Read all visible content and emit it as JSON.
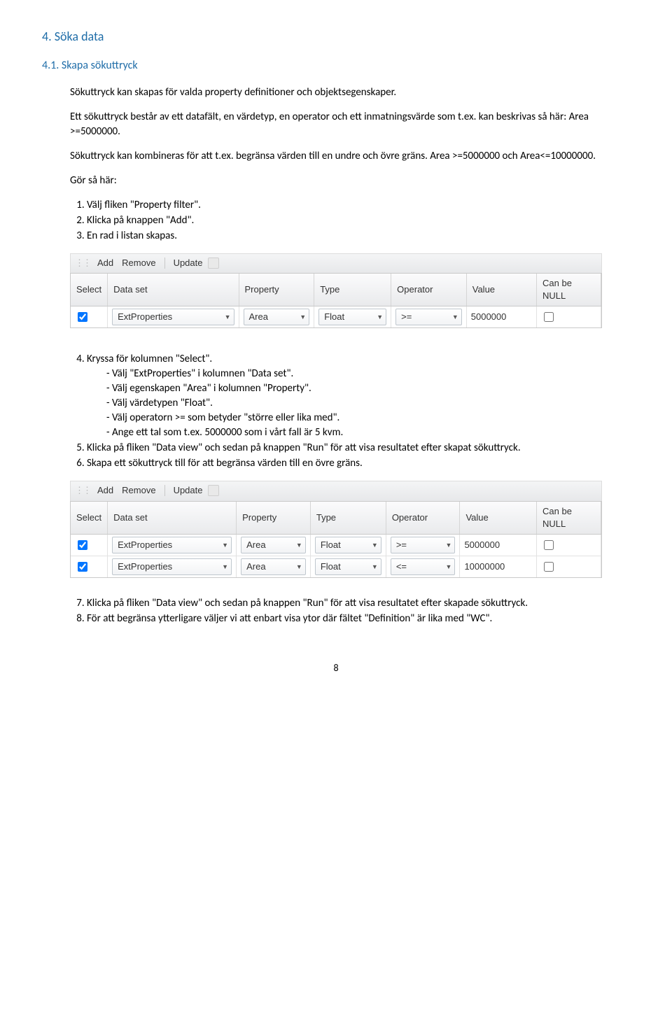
{
  "headings": {
    "h1": "4. Söka data",
    "h2": "4.1. Skapa sökuttryck"
  },
  "intro": {
    "p1": "Sökuttryck kan skapas för valda property definitioner och objektsegenskaper.",
    "p2": "Ett sökuttryck består av ett datafält, en värdetyp, en operator och ett inmatningsvärde som t.ex. kan beskrivas så här: Area >=5000000.",
    "p3": "Sökuttryck kan kombineras för att t.ex. begränsa värden till en undre och övre gräns. Area >=5000000 och Area<=10000000.",
    "p4": "Gör så här:"
  },
  "list1": {
    "i1": "Välj fliken \"Property filter\".",
    "i2": "Klicka på knappen \"Add\".",
    "i3": "En rad i listan skapas."
  },
  "toolbar": {
    "add": "Add",
    "remove": "Remove",
    "update": "Update"
  },
  "columns": {
    "select": "Select",
    "dataset": "Data set",
    "property": "Property",
    "type": "Type",
    "operator": "Operator",
    "value": "Value",
    "cannull": "Can be NULL"
  },
  "row1": {
    "dataset": "ExtProperties",
    "property": "Area",
    "type": "Float",
    "operator": ">=",
    "value": "5000000"
  },
  "row2": {
    "dataset": "ExtProperties",
    "property": "Area",
    "type": "Float",
    "operator": "<=",
    "value": "10000000"
  },
  "list2": {
    "i4": "Kryssa för kolumnen \"Select\".",
    "i4a": "- Välj \"ExtProperties\" i kolumnen \"Data set\".",
    "i4b": "- Välj egenskapen \"Area\" i kolumnen \"Property\".",
    "i4c": "- Välj värdetypen \"Float\".",
    "i4d": "- Välj operatorn >= som betyder \"större eller lika med\".",
    "i4e": "- Ange ett tal som t.ex. 5000000 som i vårt fall är 5 kvm.",
    "i5": "Klicka på fliken \"Data view\" och sedan på knappen \"Run\" för att visa resultatet efter skapat sökuttryck.",
    "i6": "Skapa ett sökuttryck till för att begränsa värden till en övre gräns."
  },
  "list3": {
    "i7": "Klicka på fliken \"Data view\" och sedan på knappen \"Run\" för att visa resultatet efter skapade sökuttryck.",
    "i8": "För att begränsa ytterligare väljer vi att enbart visa ytor där fältet \"Definition\" är lika med \"WC\"."
  },
  "page": "8"
}
